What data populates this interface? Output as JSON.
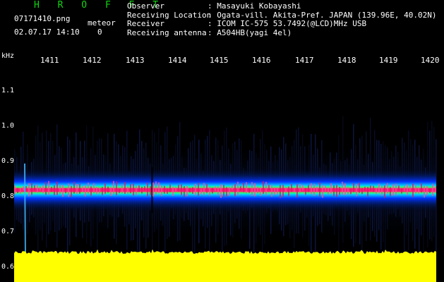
{
  "header": {
    "title": "H R O F F T",
    "filename": "07171410.png",
    "datetime": "02.07.17 14:10",
    "meteor_label": "meteor",
    "meteor_count": "0"
  },
  "info": [
    {
      "label": "Observer",
      "value": ": Masayuki Kobayashi"
    },
    {
      "label": "Receiving Location",
      "value": ": Ogata-vill. Akita-Pref. JAPAN (139.96E, 40.02N)"
    },
    {
      "label": "Receiver",
      "value": ": ICOM IC-575 53.7492(@LCD)MHz USB"
    },
    {
      "label": "Receiving antenna",
      "value": ": A504HB(yagi 4el)"
    }
  ],
  "axes": {
    "y_unit": "kHz",
    "y_ticks": [
      "1.1",
      "1.0",
      "0.9",
      "0.8",
      "0.7",
      "0.6"
    ],
    "x_ticks": [
      "1411",
      "1412",
      "1413",
      "1414",
      "1415",
      "1416",
      "1417",
      "1418",
      "1419",
      "1420"
    ]
  },
  "colors": {
    "title": "#11d611",
    "band_core": "#ff1a6e",
    "noise_floor": "#ffff00",
    "background": "#000000"
  }
}
